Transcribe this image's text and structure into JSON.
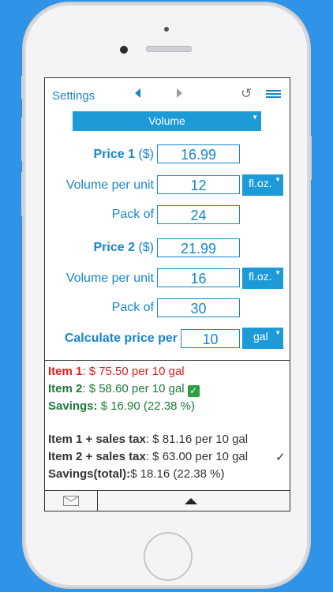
{
  "topbar": {
    "settings_label": "Settings",
    "undo_glyph": "↺"
  },
  "category": {
    "value": "Volume"
  },
  "price1": {
    "label": "Price 1",
    "suffix": "($)",
    "value": "16.99"
  },
  "volume1": {
    "label": "Volume per unit",
    "value": "12",
    "unit": "fl.oz."
  },
  "pack1": {
    "label": "Pack of",
    "value": "24"
  },
  "price2": {
    "label": "Price 2",
    "suffix": "($)",
    "value": "21.99"
  },
  "volume2": {
    "label": "Volume per unit",
    "value": "16",
    "unit": "fl.oz."
  },
  "pack2": {
    "label": "Pack of",
    "value": "30"
  },
  "calc": {
    "label": "Calculate price per",
    "value": "10",
    "unit": "gal"
  },
  "results": {
    "item1_label": "Item 1",
    "item1_value": ": $ 75.50 per 10 gal",
    "item2_label": "Item 2",
    "item2_value": ": $ 58.60 per 10 gal",
    "savings_label": "Savings:",
    "savings_value": " $ 16.90 (22.38 %)",
    "tax1_label": "Item 1 + sales tax",
    "tax1_value": ": $ 81.16 per 10 gal",
    "tax2_label": "Item 2 + sales tax",
    "tax2_value": ": $ 63.00 per 10 gal",
    "tax2_mark": "✓",
    "total_label": "Savings(total):",
    "total_value": "$ 18.16 (22.38 %)"
  },
  "icons": {
    "prev": "arrow-left-icon",
    "next": "arrow-right-icon",
    "undo": "undo-icon",
    "menu": "menu-icon",
    "mail": "mail-icon",
    "expand": "triangle-up-icon"
  },
  "colors": {
    "accent": "#1a86c7",
    "button_fill": "#1d9ad8",
    "red": "#e31d1d",
    "green": "#1d7a3a",
    "background": "#2f93e8"
  }
}
